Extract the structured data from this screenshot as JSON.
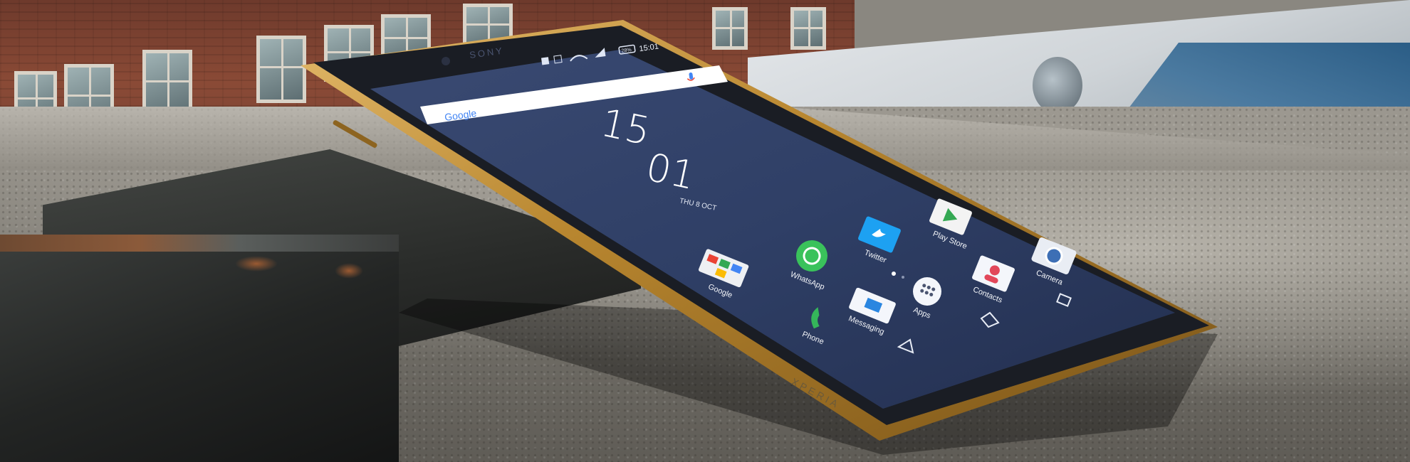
{
  "status_bar": {
    "brand": "SONY",
    "battery": "28%",
    "time": "15:01"
  },
  "search_widget": {
    "logo": "Google",
    "mic_icon": "mic-icon"
  },
  "clock": {
    "hour": "15",
    "minute": "01",
    "date": "THU 8 OCT"
  },
  "apps": [
    {
      "label": "Google",
      "icon": "google-folder-icon"
    },
    {
      "label": "WhatsApp",
      "icon": "whatsapp-icon"
    },
    {
      "label": "Twitter",
      "icon": "twitter-icon"
    },
    {
      "label": "Play Store",
      "icon": "play-store-icon"
    },
    {
      "label": "Phone",
      "icon": "phone-icon"
    },
    {
      "label": "Messaging",
      "icon": "messaging-icon"
    },
    {
      "label": "Apps",
      "icon": "apps-grid-icon"
    },
    {
      "label": "Contacts",
      "icon": "contacts-icon"
    },
    {
      "label": "Camera",
      "icon": "camera-icon"
    }
  ],
  "nav_bar": {
    "back": "back-icon",
    "home": "home-icon",
    "recents": "recents-icon"
  },
  "device_mark": "XPERIA",
  "colors": {
    "gold_frame": "#b8862f",
    "screen_bg": "#2f3f66",
    "bezel": "#1a1d24"
  }
}
